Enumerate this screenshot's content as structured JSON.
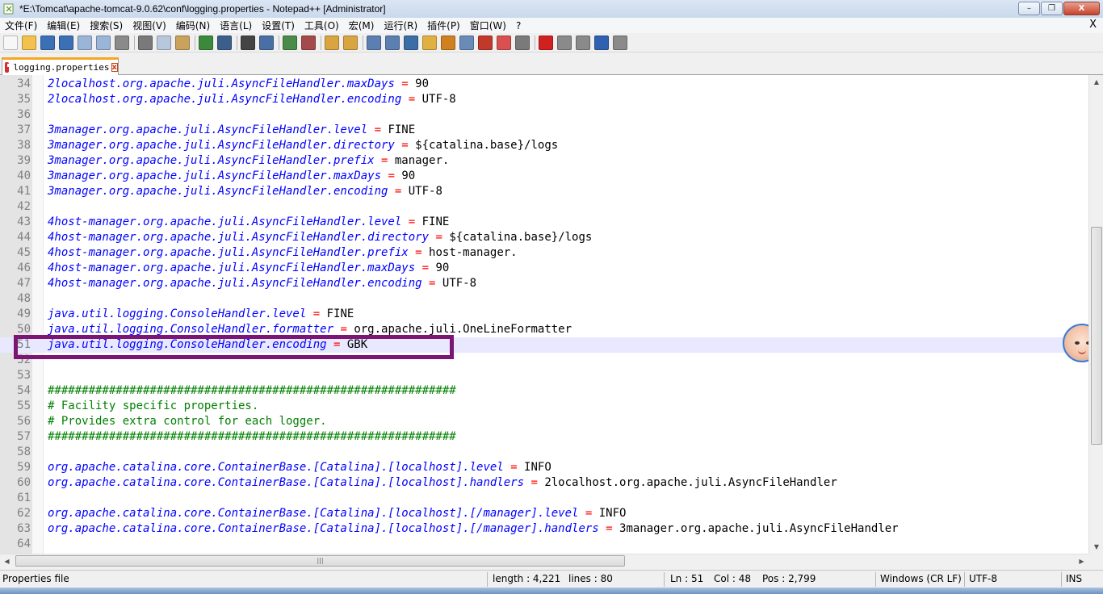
{
  "window": {
    "title": "*E:\\Tomcat\\apache-tomcat-9.0.62\\conf\\logging.properties - Notepad++ [Administrator]",
    "buttons": {
      "minimize": "–",
      "maximize": "❐",
      "close": "X"
    }
  },
  "menu": {
    "items": [
      "文件(F)",
      "编辑(E)",
      "搜索(S)",
      "视图(V)",
      "编码(N)",
      "语言(L)",
      "设置(T)",
      "工具(O)",
      "宏(M)",
      "运行(R)",
      "插件(P)",
      "窗口(W)",
      "?"
    ],
    "close_label": "X"
  },
  "toolbar": {
    "icons": [
      {
        "name": "new-file-icon",
        "color": "#f7f7f7"
      },
      {
        "name": "open-file-icon",
        "color": "#f2c14e"
      },
      {
        "name": "save-icon",
        "color": "#3b6fb6"
      },
      {
        "name": "save-all-icon",
        "color": "#3b6fb6"
      },
      {
        "name": "close-file-icon",
        "color": "#9ab5d8"
      },
      {
        "name": "close-all-icon",
        "color": "#9ab5d8"
      },
      {
        "name": "print-icon",
        "color": "#8a8a8a"
      },
      "sep",
      {
        "name": "cut-icon",
        "color": "#7a7a7a"
      },
      {
        "name": "copy-icon",
        "color": "#b8c8dc"
      },
      {
        "name": "paste-icon",
        "color": "#c9a25c"
      },
      "sep",
      {
        "name": "undo-icon",
        "color": "#3b8a3b"
      },
      {
        "name": "redo-icon",
        "color": "#3b5f8a"
      },
      "sep",
      {
        "name": "find-icon",
        "color": "#444444"
      },
      {
        "name": "replace-icon",
        "color": "#4a6fa5"
      },
      "sep",
      {
        "name": "zoom-in-icon",
        "color": "#4a8a4a"
      },
      {
        "name": "zoom-out-icon",
        "color": "#a54a4a"
      },
      "sep",
      {
        "name": "sync-vertical-icon",
        "color": "#d9a540"
      },
      {
        "name": "sync-horizontal-icon",
        "color": "#d9a540"
      },
      "sep",
      {
        "name": "word-wrap-icon",
        "color": "#5a7fb0"
      },
      {
        "name": "show-all-chars-icon",
        "color": "#5a7fb0"
      },
      {
        "name": "indent-guide-icon",
        "color": "#3a6ea5"
      },
      {
        "name": "udl-icon",
        "color": "#e0b040"
      },
      {
        "name": "doc-map-icon",
        "color": "#d08020"
      },
      {
        "name": "function-list-icon",
        "color": "#6a8ab8"
      },
      {
        "name": "folder-workspace-icon",
        "color": "#c0392b"
      },
      {
        "name": "monitoring-icon",
        "color": "#d95050"
      },
      {
        "name": "eye-icon",
        "color": "#7a7a7a"
      },
      "sep",
      {
        "name": "record-macro-icon",
        "color": "#d02020"
      },
      {
        "name": "stop-macro-icon",
        "color": "#8a8a8a"
      },
      {
        "name": "play-macro-icon",
        "color": "#8a8a8a"
      },
      {
        "name": "run-macro-multiple-icon",
        "color": "#3060b0"
      },
      {
        "name": "save-macro-icon",
        "color": "#8a8a8a"
      }
    ]
  },
  "tab": {
    "label": "logging.properties",
    "close": "x"
  },
  "editor": {
    "lines": [
      {
        "n": "34",
        "key": "2localhost.org.apache.juli.AsyncFileHandler.maxDays",
        "val": "90"
      },
      {
        "n": "35",
        "key": "2localhost.org.apache.juli.AsyncFileHandler.encoding",
        "val": "UTF-8"
      },
      {
        "n": "36"
      },
      {
        "n": "37",
        "key": "3manager.org.apache.juli.AsyncFileHandler.level",
        "val": "FINE"
      },
      {
        "n": "38",
        "key": "3manager.org.apache.juli.AsyncFileHandler.directory",
        "val": "${catalina.base}/logs"
      },
      {
        "n": "39",
        "key": "3manager.org.apache.juli.AsyncFileHandler.prefix",
        "val": "manager."
      },
      {
        "n": "40",
        "key": "3manager.org.apache.juli.AsyncFileHandler.maxDays",
        "val": "90"
      },
      {
        "n": "41",
        "key": "3manager.org.apache.juli.AsyncFileHandler.encoding",
        "val": "UTF-8"
      },
      {
        "n": "42"
      },
      {
        "n": "43",
        "key": "4host-manager.org.apache.juli.AsyncFileHandler.level",
        "val": "FINE"
      },
      {
        "n": "44",
        "key": "4host-manager.org.apache.juli.AsyncFileHandler.directory",
        "val": "${catalina.base}/logs"
      },
      {
        "n": "45",
        "key": "4host-manager.org.apache.juli.AsyncFileHandler.prefix",
        "val": "host-manager."
      },
      {
        "n": "46",
        "key": "4host-manager.org.apache.juli.AsyncFileHandler.maxDays",
        "val": "90"
      },
      {
        "n": "47",
        "key": "4host-manager.org.apache.juli.AsyncFileHandler.encoding",
        "val": "UTF-8"
      },
      {
        "n": "48"
      },
      {
        "n": "49",
        "key": "java.util.logging.ConsoleHandler.level",
        "val": "FINE"
      },
      {
        "n": "50",
        "key": "java.util.logging.ConsoleHandler.formatter",
        "val": "org.apache.juli.OneLineFormatter"
      },
      {
        "n": "51",
        "key": "java.util.logging.ConsoleHandler.encoding",
        "val": "GBK",
        "current": true
      },
      {
        "n": "52"
      },
      {
        "n": "53"
      },
      {
        "n": "54",
        "comment": "############################################################"
      },
      {
        "n": "55",
        "comment": "# Facility specific properties."
      },
      {
        "n": "56",
        "comment": "# Provides extra control for each logger."
      },
      {
        "n": "57",
        "comment": "############################################################"
      },
      {
        "n": "58"
      },
      {
        "n": "59",
        "key": "org.apache.catalina.core.ContainerBase.[Catalina].[localhost].level",
        "val": "INFO"
      },
      {
        "n": "60",
        "key": "org.apache.catalina.core.ContainerBase.[Catalina].[localhost].handlers",
        "val": "2localhost.org.apache.juli.AsyncFileHandler"
      },
      {
        "n": "61"
      },
      {
        "n": "62",
        "key": "org.apache.catalina.core.ContainerBase.[Catalina].[localhost].[/manager].level",
        "val": "INFO"
      },
      {
        "n": "63",
        "key": "org.apache.catalina.core.ContainerBase.[Catalina].[localhost].[/manager].handlers",
        "val": "3manager.org.apache.juli.AsyncFileHandler"
      },
      {
        "n": "64"
      }
    ]
  },
  "hscroll_grip": "|||",
  "status": {
    "file_type": "Properties file",
    "length": "length : 4,221",
    "lines": "lines : 80",
    "ln": "Ln : 51",
    "col": "Col : 48",
    "pos": "Pos : 2,799",
    "eol": "Windows (CR LF)",
    "encoding": "UTF-8",
    "mode": "INS"
  },
  "colors": {
    "keyword": "#0000ff",
    "operator": "#ff0000",
    "comment": "#008000",
    "highlight_box": "#7b1674",
    "current_line": "#e8e8ff"
  }
}
